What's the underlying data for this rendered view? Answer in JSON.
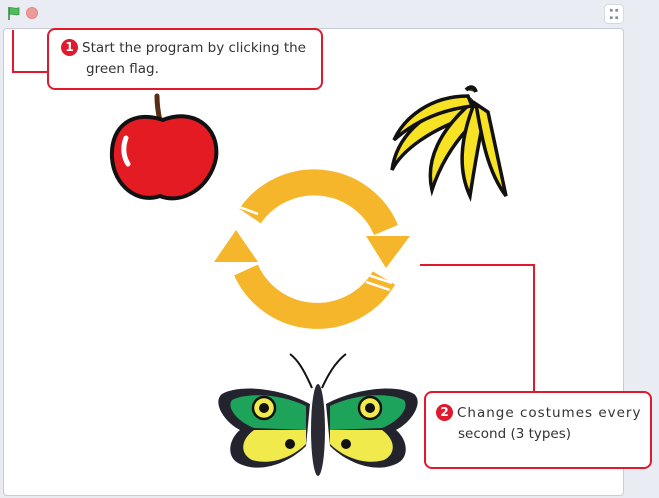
{
  "toolbar": {
    "flag_icon": "green-flag-icon",
    "stop_icon": "stop-icon",
    "fullscreen_icon": "fullscreen-exit-icon"
  },
  "stage": {
    "sprites": [
      "apple",
      "banana",
      "butterfly"
    ],
    "cycle_icon": "cycle-arrows-icon"
  },
  "callouts": [
    {
      "number": "1",
      "line1": "Start the program by clicking the",
      "line2": "green flag."
    },
    {
      "number": "2",
      "line1": "Change costumes every",
      "line2": "second (3 types)"
    }
  ],
  "colors": {
    "accent": "#e0192d",
    "flag": "#3fa14b",
    "stop": "#ec9b9b",
    "cycle": "#f6b62b",
    "apple": "#e51b23",
    "banana": "#f7e224",
    "butterfly_green": "#1ea35b",
    "butterfly_yellow": "#f0ea4d"
  }
}
